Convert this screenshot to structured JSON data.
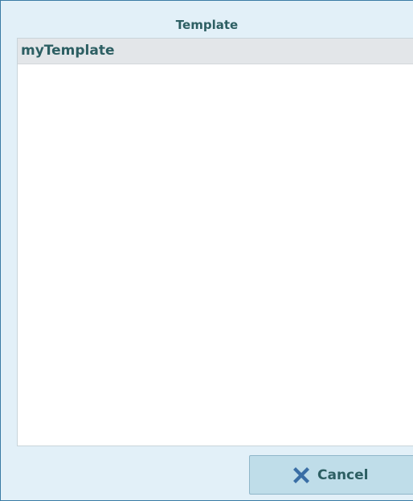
{
  "dialog": {
    "title": "Template",
    "templates": [
      {
        "label": "myTemplate"
      }
    ],
    "cancel_label": "Cancel"
  },
  "icons": {
    "cancel": "close-x-icon"
  },
  "colors": {
    "background": "#e2f0f8",
    "text": "#2d5f63",
    "selected_row": "#e3e6e9",
    "button": "#bfdde9",
    "cancel_icon": "#3a6ea5"
  }
}
